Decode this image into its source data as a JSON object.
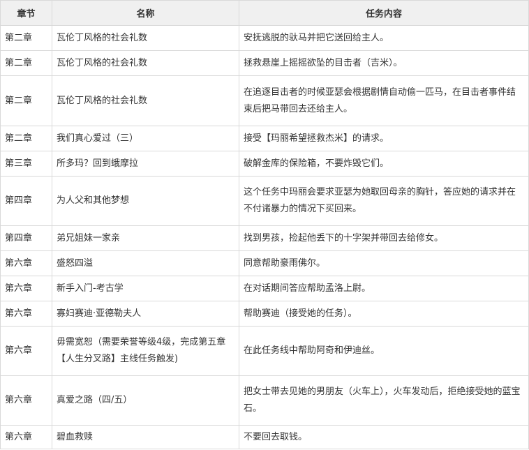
{
  "table": {
    "headers": {
      "chapter": "章节",
      "name": "名称",
      "content": "任务内容"
    },
    "rows": [
      {
        "chapter": "第二章",
        "name": "瓦伦丁风格的社会礼数",
        "content": "安抚逃脱的驮马并把它送回给主人。"
      },
      {
        "chapter": "第二章",
        "name": "瓦伦丁风格的社会礼数",
        "content": "拯救悬崖上摇摇欲坠的目击者（吉米）。"
      },
      {
        "chapter": "第二章",
        "name": "瓦伦丁风格的社会礼数",
        "content": "在追逐目击者的时候亚瑟会根据剧情自动偷一匹马，在目击者事件结束后把马带回去还给主人。"
      },
      {
        "chapter": "第二章",
        "name": "我们真心爱过（三）",
        "content": "接受【玛丽希望拯救杰米】的请求。"
      },
      {
        "chapter": "第三章",
        "name": "所多玛？回到蛾摩拉",
        "content": "破解金库的保险箱，不要炸毁它们。"
      },
      {
        "chapter": "第四章",
        "name": "为人父和其他梦想",
        "content": "这个任务中玛丽会要求亚瑟为她取回母亲的胸针，答应她的请求并在不付诸暴力的情况下买回来。"
      },
      {
        "chapter": "第四章",
        "name": "弟兄姐妹一家亲",
        "content": "找到男孩，捡起他丢下的十字架并带回去给修女。"
      },
      {
        "chapter": "第六章",
        "name": "盛怒四溢",
        "content": "同意帮助豪雨佛尔。"
      },
      {
        "chapter": "第六章",
        "name": "新手入门-考古学",
        "content": "在对话期间答应帮助孟洛上尉。"
      },
      {
        "chapter": "第六章",
        "name": "寡妇赛迪·亚德勒夫人",
        "content": "帮助赛迪（接受她的任务）。"
      },
      {
        "chapter": "第六章",
        "name": "毋需宽恕（需要荣誉等级4级，完成第五章【人生分叉路】主线任务触发)",
        "content": "在此任务线中帮助阿奇和伊迪丝。"
      },
      {
        "chapter": "第六章",
        "name": "真爱之路（四/五）",
        "content": "把女士带去见她的男朋友（火车上），火车发动后，拒绝接受她的蓝宝石。"
      },
      {
        "chapter": "第六章",
        "name": "碧血救赎",
        "content": "不要回去取钱。"
      }
    ]
  }
}
